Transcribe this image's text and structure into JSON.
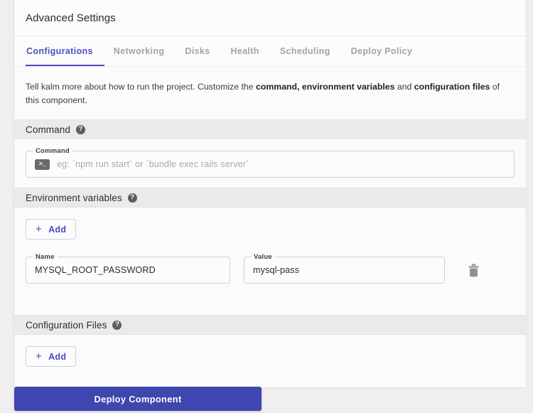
{
  "window": {
    "title": "Advanced Settings"
  },
  "tabs": [
    {
      "label": "Configurations",
      "active": true
    },
    {
      "label": "Networking",
      "active": false
    },
    {
      "label": "Disks",
      "active": false
    },
    {
      "label": "Health",
      "active": false
    },
    {
      "label": "Scheduling",
      "active": false
    },
    {
      "label": "Deploy Policy",
      "active": false
    }
  ],
  "intro": {
    "part1": "Tell kalm more about how to run the project. Customize the ",
    "bold1": "command, environment variables",
    "part2": " and ",
    "bold2": "configuration files",
    "part3": " of this component."
  },
  "sections": {
    "command": {
      "title": "Command",
      "help_icon": "help-circle-icon",
      "field_label": "Command",
      "field_value": "",
      "field_placeholder": "eg: `npm run start` or `bundle exec rails server`",
      "prefix_icon": "terminal-icon",
      "prefix_icon_glyph": ">_"
    },
    "environment_variables": {
      "title": "Environment variables",
      "help_icon": "help-circle-icon",
      "add_label": "Add",
      "add_icon": "plus-icon",
      "columns": [
        "Name",
        "Value"
      ],
      "rows": [
        {
          "name_label": "Name",
          "name_value": "MYSQL_ROOT_PASSWORD",
          "value_label": "Value",
          "value_value": "mysql-pass",
          "delete_icon": "trash-icon"
        }
      ]
    },
    "configuration_files": {
      "title": "Configuration Files",
      "help_icon": "help-circle-icon",
      "add_label": "Add",
      "add_icon": "plus-icon"
    }
  },
  "footer": {
    "deploy_label": "Deploy Component"
  },
  "colors": {
    "accent": "#4a4ac0",
    "deploy_button": "#3f46b0",
    "tab_inactive": "#a3a3a9",
    "section_bar": "#eaeaec",
    "page_background": "#efeff1",
    "card_background": "#fbfbfc"
  }
}
